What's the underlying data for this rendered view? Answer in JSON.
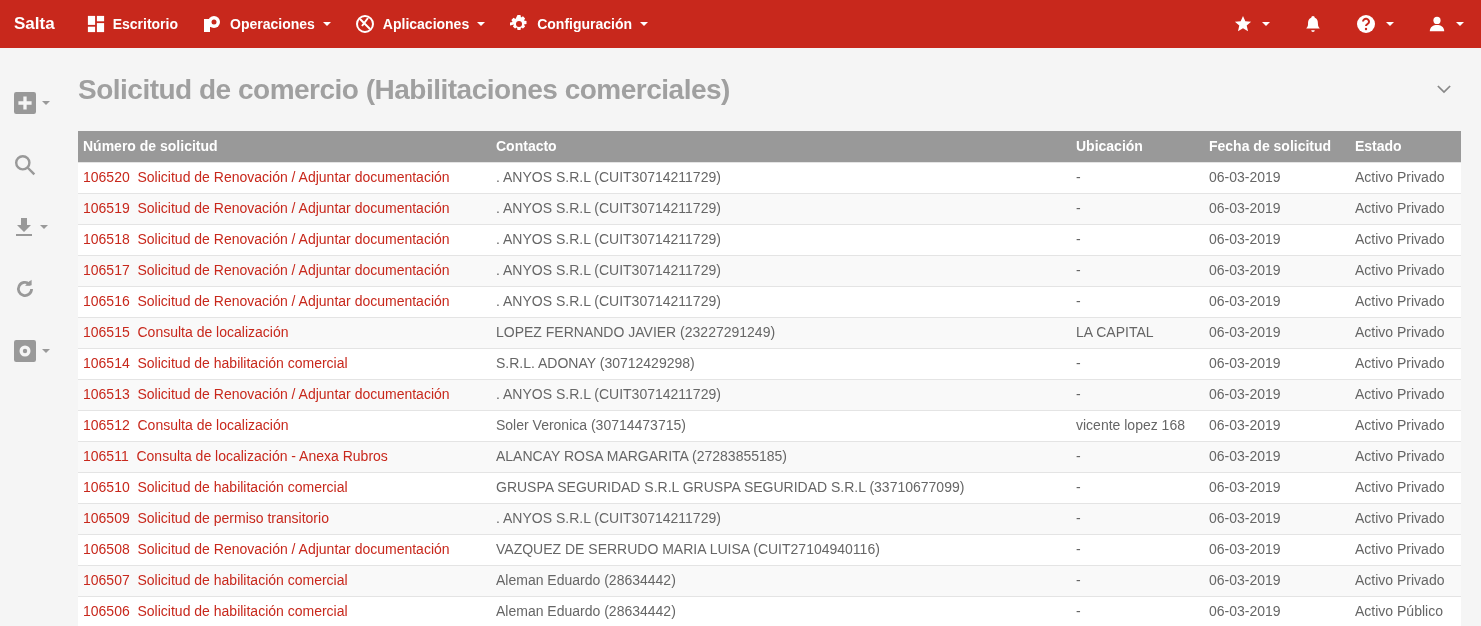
{
  "navbar": {
    "brand": "Salta",
    "items": [
      {
        "label": "Escritorio",
        "dropdown": false
      },
      {
        "label": "Operaciones",
        "dropdown": true
      },
      {
        "label": "Aplicaciones",
        "dropdown": true
      },
      {
        "label": "Configuración",
        "dropdown": true
      }
    ],
    "right_items": [
      {
        "dropdown": true
      },
      {
        "dropdown": false
      },
      {
        "dropdown": true
      },
      {
        "dropdown": true
      }
    ]
  },
  "sidebar": {
    "tools": [
      {
        "dropdown": true
      },
      {
        "dropdown": false
      },
      {
        "dropdown": true
      },
      {
        "dropdown": false
      },
      {
        "dropdown": true
      }
    ]
  },
  "page": {
    "title": "Solicitud de comercio (Habilitaciones comerciales)"
  },
  "table": {
    "columns": [
      "Número de solicitud",
      "Contacto",
      "Ubicación",
      "Fecha de solicitud",
      "Estado"
    ],
    "rows": [
      {
        "number": "106520",
        "request": "Solicitud de Renovación / Adjuntar documentación",
        "contact": ". ANYOS S.R.L (CUIT30714211729)",
        "location": "-",
        "date": "06-03-2019",
        "status": "Activo Privado"
      },
      {
        "number": "106519",
        "request": "Solicitud de Renovación / Adjuntar documentación",
        "contact": ". ANYOS S.R.L (CUIT30714211729)",
        "location": "-",
        "date": "06-03-2019",
        "status": "Activo Privado"
      },
      {
        "number": "106518",
        "request": "Solicitud de Renovación / Adjuntar documentación",
        "contact": ". ANYOS S.R.L (CUIT30714211729)",
        "location": "-",
        "date": "06-03-2019",
        "status": "Activo Privado"
      },
      {
        "number": "106517",
        "request": "Solicitud de Renovación / Adjuntar documentación",
        "contact": ". ANYOS S.R.L (CUIT30714211729)",
        "location": "-",
        "date": "06-03-2019",
        "status": "Activo Privado"
      },
      {
        "number": "106516",
        "request": "Solicitud de Renovación / Adjuntar documentación",
        "contact": ". ANYOS S.R.L (CUIT30714211729)",
        "location": "-",
        "date": "06-03-2019",
        "status": "Activo Privado"
      },
      {
        "number": "106515",
        "request": "Consulta de localización",
        "contact": "LOPEZ FERNANDO JAVIER (23227291249)",
        "location": "LA CAPITAL",
        "date": "06-03-2019",
        "status": "Activo Privado"
      },
      {
        "number": "106514",
        "request": "Solicitud de habilitación comercial",
        "contact": "S.R.L. ADONAY (30712429298)",
        "location": "-",
        "date": "06-03-2019",
        "status": "Activo Privado"
      },
      {
        "number": "106513",
        "request": "Solicitud de Renovación / Adjuntar documentación",
        "contact": ". ANYOS S.R.L (CUIT30714211729)",
        "location": "-",
        "date": "06-03-2019",
        "status": "Activo Privado"
      },
      {
        "number": "106512",
        "request": "Consulta de localización",
        "contact": "Soler Veronica (30714473715)",
        "location": "vicente lopez 168",
        "date": "06-03-2019",
        "status": "Activo Privado"
      },
      {
        "number": "106511",
        "request": "Consulta de localización - Anexa Rubros",
        "contact": "ALANCAY ROSA MARGARITA (27283855185)",
        "location": "-",
        "date": "06-03-2019",
        "status": "Activo Privado"
      },
      {
        "number": "106510",
        "request": "Solicitud de habilitación comercial",
        "contact": "GRUSPA SEGURIDAD S.R.L GRUSPA SEGURIDAD S.R.L (33710677099)",
        "location": "-",
        "date": "06-03-2019",
        "status": "Activo Privado"
      },
      {
        "number": "106509",
        "request": "Solicitud de permiso transitorio",
        "contact": ". ANYOS S.R.L (CUIT30714211729)",
        "location": "-",
        "date": "06-03-2019",
        "status": "Activo Privado"
      },
      {
        "number": "106508",
        "request": "Solicitud de Renovación / Adjuntar documentación",
        "contact": "VAZQUEZ DE SERRUDO MARIA LUISA (CUIT27104940116)",
        "location": "-",
        "date": "06-03-2019",
        "status": "Activo Privado"
      },
      {
        "number": "106507",
        "request": "Solicitud de habilitación comercial",
        "contact": "Aleman Eduardo (28634442)",
        "location": "-",
        "date": "06-03-2019",
        "status": "Activo Privado"
      },
      {
        "number": "106506",
        "request": "Solicitud de habilitación comercial",
        "contact": "Aleman Eduardo (28634442)",
        "location": "-",
        "date": "06-03-2019",
        "status": "Activo Público"
      }
    ]
  }
}
